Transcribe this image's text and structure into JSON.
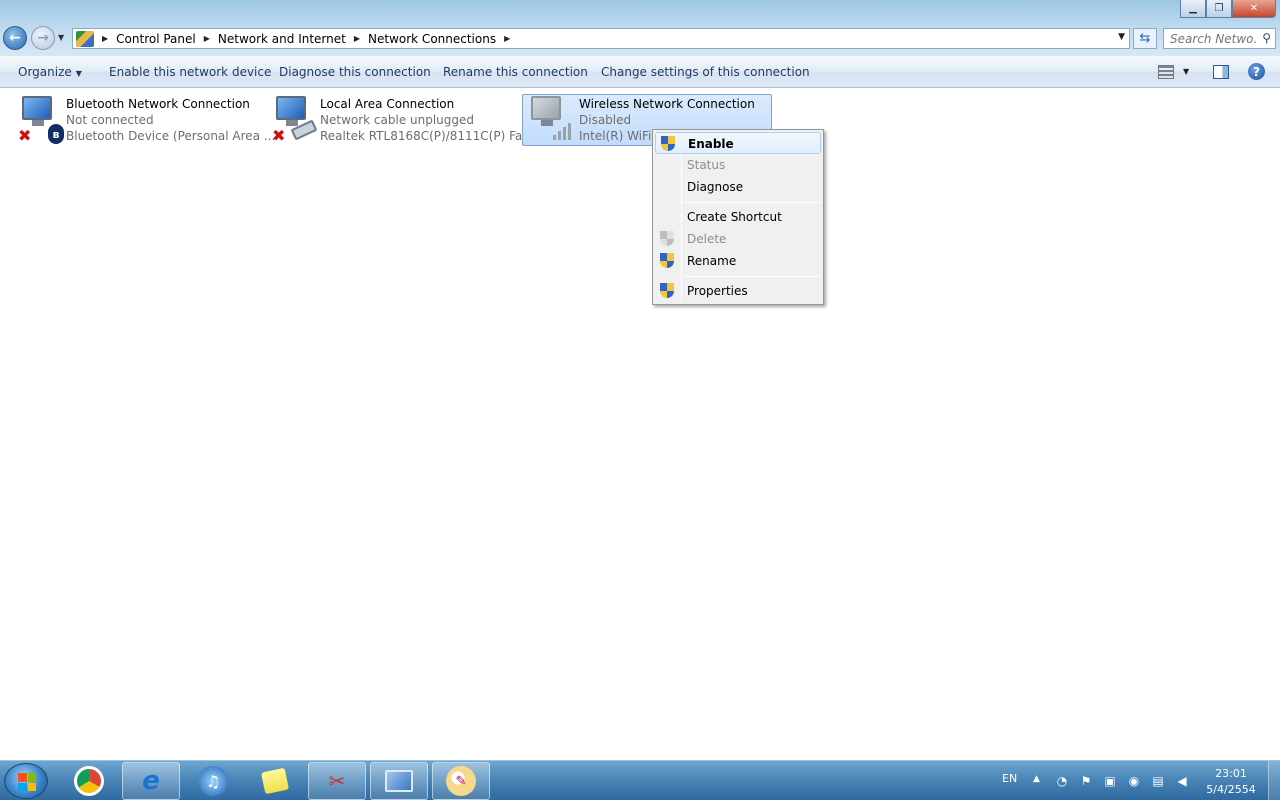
{
  "window": {
    "minimize_glyph": "▁",
    "restore_glyph": "❐",
    "close_glyph": "✕"
  },
  "nav": {
    "back_glyph": "←",
    "forward_glyph": "→"
  },
  "breadcrumb": [
    "Control Panel",
    "Network and Internet",
    "Network Connections"
  ],
  "search": {
    "placeholder": "Search Netwo..."
  },
  "commands": {
    "organize": "Organize",
    "enable_device": "Enable this network device",
    "diagnose": "Diagnose this connection",
    "rename": "Rename this connection",
    "change_settings": "Change settings of this connection"
  },
  "connections": [
    {
      "name": "Bluetooth Network Connection",
      "status": "Not connected",
      "device": "Bluetooth Device (Personal Area ..."
    },
    {
      "name": "Local Area Connection",
      "status": "Network cable unplugged",
      "device": "Realtek RTL8168C(P)/8111C(P) Fa..."
    },
    {
      "name": "Wireless Network Connection",
      "status": "Disabled",
      "device": "Intel(R) WiFi L"
    }
  ],
  "context_menu": {
    "enable": "Enable",
    "status": "Status",
    "diagnose": "Diagnose",
    "create_shortcut": "Create Shortcut",
    "delete": "Delete",
    "rename": "Rename",
    "properties": "Properties"
  },
  "taskbar": {
    "language": "EN",
    "time": "23:01",
    "date": "5/4/2554"
  },
  "colors": {
    "accent": "#2a66b0",
    "selection": "#c1dcfb",
    "taskbar": "#4a86b8"
  }
}
